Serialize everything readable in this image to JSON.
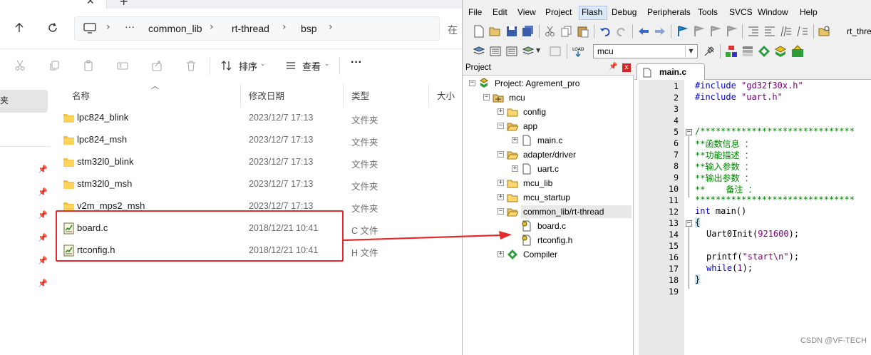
{
  "explorer": {
    "tab_close": "✕",
    "tab_new": "+",
    "breadcrumb": [
      "···",
      "common_lib",
      "rt-thread",
      "bsp"
    ],
    "search_cut": "在",
    "toolbar": {
      "sort_label": "排序",
      "view_label": "查看",
      "more_label": "···"
    },
    "left_pane": {
      "selected_label": "夹"
    },
    "columns": {
      "name": "名称",
      "date": "修改日期",
      "type": "类型",
      "size": "大小"
    },
    "files": [
      {
        "name": "lpc824_blink",
        "date": "2023/12/7 17:13",
        "type": "文件夹",
        "icon": "folder-icon"
      },
      {
        "name": "lpc824_msh",
        "date": "2023/12/7 17:13",
        "type": "文件夹",
        "icon": "folder-icon"
      },
      {
        "name": "stm32l0_blink",
        "date": "2023/12/7 17:13",
        "type": "文件夹",
        "icon": "folder-icon"
      },
      {
        "name": "stm32l0_msh",
        "date": "2023/12/7 17:13",
        "type": "文件夹",
        "icon": "folder-icon"
      },
      {
        "name": "v2m_mps2_msh",
        "date": "2023/12/7 17:13",
        "type": "文件夹",
        "icon": "folder-icon"
      },
      {
        "name": "board.c",
        "date": "2018/12/21 10:41",
        "type": "C 文件",
        "icon": "c-file-icon"
      },
      {
        "name": "rtconfig.h",
        "date": "2018/12/21 10:41",
        "type": "H 文件",
        "icon": "h-file-icon"
      }
    ],
    "highlight_color": "#e32b2b"
  },
  "keil": {
    "menus": [
      "File",
      "Edit",
      "View",
      "Project",
      "Flash",
      "Debug",
      "Peripherals",
      "Tools",
      "SVCS",
      "Window",
      "Help"
    ],
    "toolbar_text": "rt_thre",
    "target": "mcu",
    "project_panel": {
      "title": "Project",
      "pin": "📌",
      "close": "x",
      "tree": [
        {
          "label": "Project: Agrement_pro",
          "kind": "project"
        },
        {
          "label": "mcu",
          "kind": "target"
        },
        {
          "label": "config",
          "kind": "group"
        },
        {
          "label": "app",
          "kind": "group"
        },
        {
          "label": "main.c",
          "kind": "file"
        },
        {
          "label": "adapter/driver",
          "kind": "group"
        },
        {
          "label": "uart.c",
          "kind": "file"
        },
        {
          "label": "mcu_lib",
          "kind": "group"
        },
        {
          "label": "mcu_startup",
          "kind": "group"
        },
        {
          "label": "common_lib/rt-thread",
          "kind": "group"
        },
        {
          "label": "board.c",
          "kind": "file"
        },
        {
          "label": "rtconfig.h",
          "kind": "header"
        },
        {
          "label": "Compiler",
          "kind": "component"
        }
      ]
    },
    "editor": {
      "tab": "main.c",
      "line_numbers": [
        "1",
        "2",
        "3",
        "4",
        "5",
        "6",
        "7",
        "8",
        "9",
        "10",
        "11",
        "12",
        "13",
        "14",
        "15",
        "16",
        "17",
        "18",
        "19"
      ],
      "lines": {
        "l1_pp": "#include",
        "l1_str": "\"gd32f30x.h\"",
        "l2_pp": "#include",
        "l2_str": "\"uart.h\"",
        "l5": "/******************************",
        "l6": "**函数信息 ：",
        "l7": "**功能描述 ：",
        "l8": "**输入参数 ：",
        "l9": "**输出参数 ：",
        "l10": "**    备注 ：",
        "l11": "*******************************",
        "l12_kw": "int",
        "l12_rest": " main()",
        "l13": "{",
        "l14_fn": "Uart0Init(",
        "l14_num": "921600",
        "l14_end": ");",
        "l16_fn": "printf(",
        "l16_str": "\"start\\n\"",
        "l16_end": ");",
        "l17_kw": "while",
        "l17_open": "(",
        "l17_num": "1",
        "l17_end": ");",
        "l18": "}"
      }
    }
  },
  "watermark": "CSDN @VF-TECH"
}
